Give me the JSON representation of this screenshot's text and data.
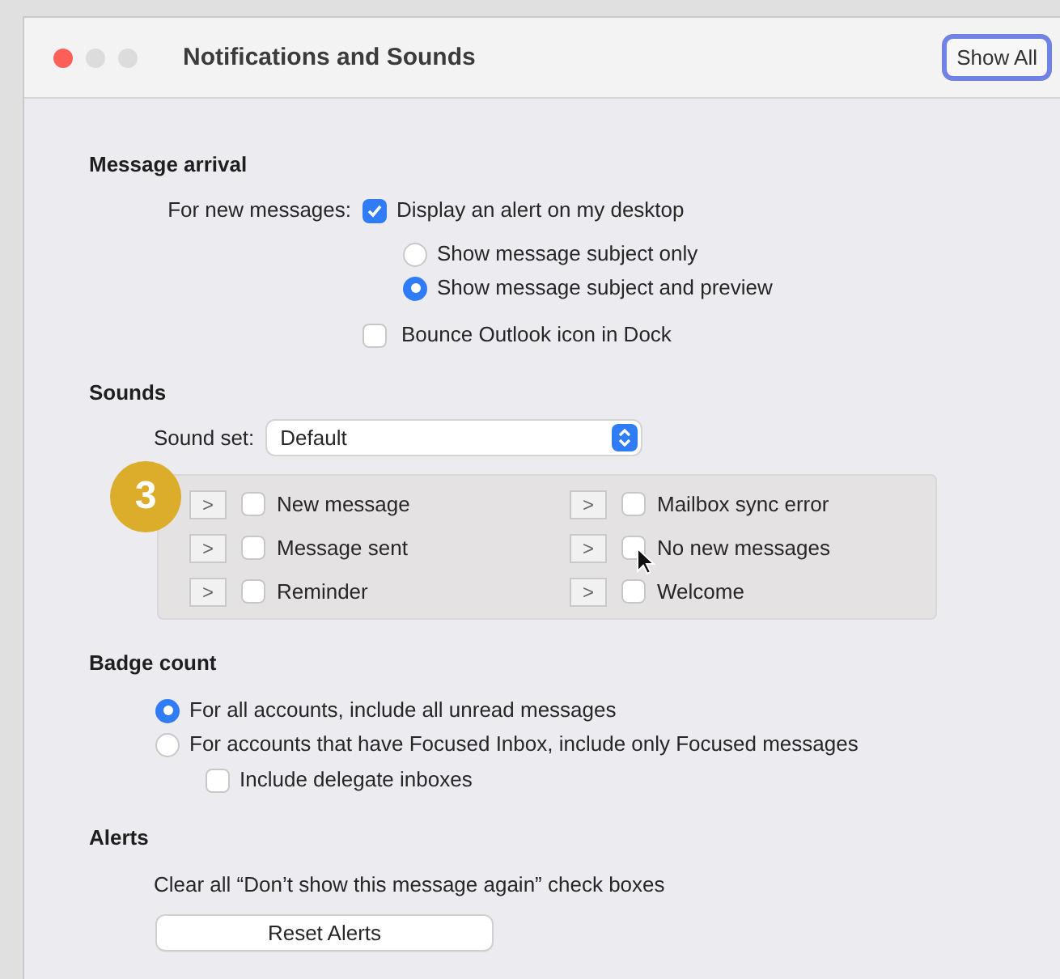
{
  "window": {
    "title": "Notifications and Sounds",
    "toolbar_button": "Show All"
  },
  "message_arrival": {
    "heading": "Message arrival",
    "label": "For new messages:",
    "display_alert": {
      "label": "Display an alert on my desktop",
      "checked": true
    },
    "alert_style": [
      {
        "label": "Show message subject only",
        "selected": false
      },
      {
        "label": "Show message subject and preview",
        "selected": true
      }
    ],
    "bounce": {
      "label": "Bounce Outlook icon in Dock",
      "checked": false
    }
  },
  "sounds": {
    "heading": "Sounds",
    "sound_set_label": "Sound set:",
    "sound_set_value": "Default",
    "play_button": ">",
    "items": [
      {
        "label": "New message",
        "checked": false
      },
      {
        "label": "Mailbox sync error",
        "checked": false
      },
      {
        "label": "Message sent",
        "checked": false
      },
      {
        "label": "No new messages",
        "checked": false
      },
      {
        "label": "Reminder",
        "checked": false
      },
      {
        "label": "Welcome",
        "checked": false
      }
    ]
  },
  "badge_count": {
    "heading": "Badge count",
    "options": [
      {
        "label": "For all accounts, include all unread messages",
        "selected": true
      },
      {
        "label": "For accounts that have Focused Inbox, include only Focused messages",
        "selected": false
      }
    ],
    "delegate": {
      "label": "Include delegate inboxes",
      "checked": false
    }
  },
  "alerts": {
    "heading": "Alerts",
    "description": "Clear all “Don’t show this message again” check boxes",
    "button": "Reset Alerts"
  },
  "step_badge": "3"
}
